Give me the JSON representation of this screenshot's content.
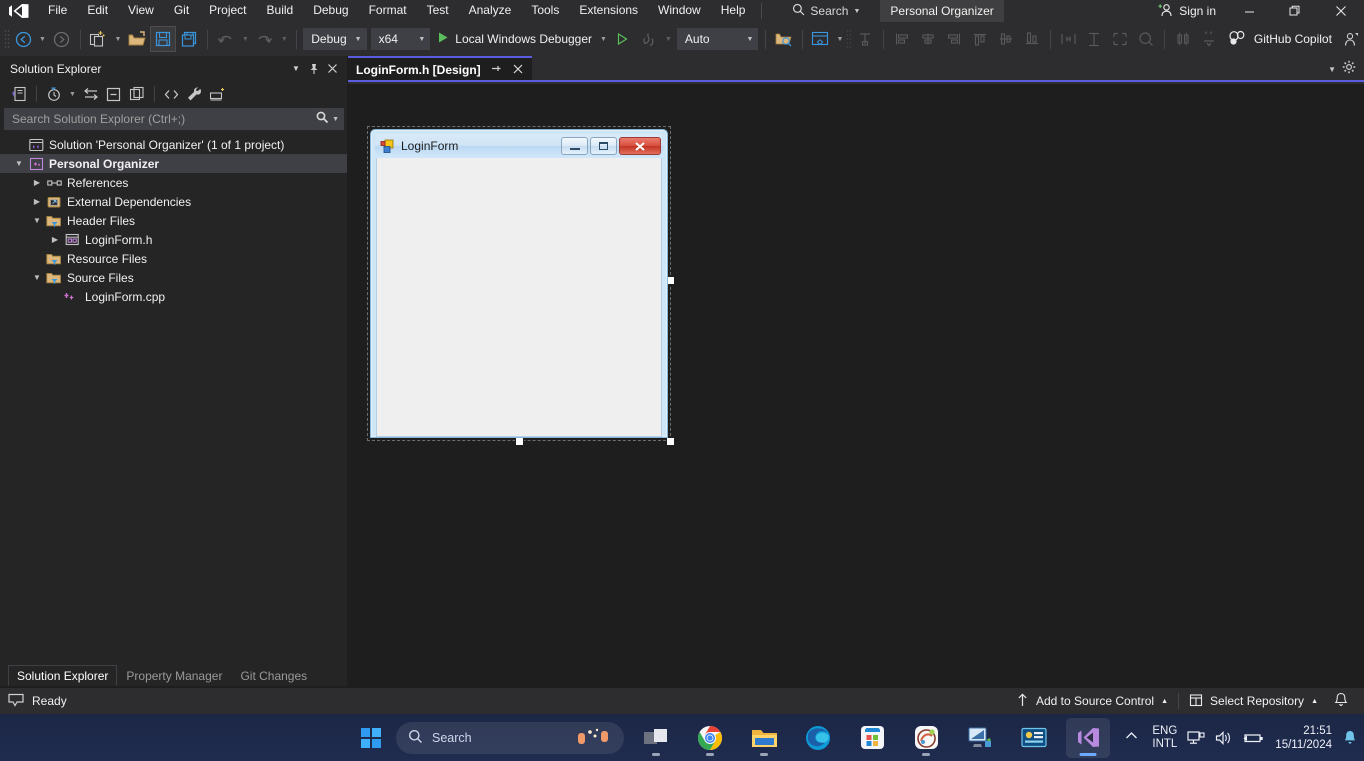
{
  "menubar": {
    "logo": "visual-studio-logo",
    "items": [
      "File",
      "Edit",
      "View",
      "Git",
      "Project",
      "Build",
      "Debug",
      "Format",
      "Test",
      "Analyze",
      "Tools",
      "Extensions",
      "Window",
      "Help"
    ],
    "search_label": "Search",
    "project_chip": "Personal Organizer",
    "signin_label": "Sign in",
    "window_buttons": {
      "minimize": "—",
      "restore": "❐",
      "close": "✕"
    }
  },
  "toolbar": {
    "configuration": "Debug",
    "platform": "x64",
    "run_label": "Local Windows Debugger",
    "process": "Auto",
    "copilot_label": "GitHub Copilot"
  },
  "solution_explorer": {
    "title": "Solution Explorer",
    "search_placeholder": "Search Solution Explorer (Ctrl+;)",
    "tree": [
      {
        "label": "Solution 'Personal Organizer' (1 of 1 project)",
        "icon": "solution-icon",
        "indent": 0,
        "twist": "",
        "bold": false,
        "selected": false
      },
      {
        "label": "Personal Organizer",
        "icon": "cpp-project-icon",
        "indent": 0,
        "twist": "expanded",
        "bold": true,
        "selected": true
      },
      {
        "label": "References",
        "icon": "references-icon",
        "indent": 1,
        "twist": "collapsed",
        "bold": false,
        "selected": false
      },
      {
        "label": "External Dependencies",
        "icon": "dependencies-icon",
        "indent": 1,
        "twist": "collapsed",
        "bold": false,
        "selected": false
      },
      {
        "label": "Header Files",
        "icon": "filter-folder-icon",
        "indent": 1,
        "twist": "expanded",
        "bold": false,
        "selected": false
      },
      {
        "label": "LoginForm.h",
        "icon": "form-file-icon",
        "indent": 2,
        "twist": "collapsed",
        "bold": false,
        "selected": false
      },
      {
        "label": "Resource Files",
        "icon": "filter-folder-icon",
        "indent": 1,
        "twist": "",
        "bold": false,
        "selected": false
      },
      {
        "label": "Source Files",
        "icon": "filter-folder-icon",
        "indent": 1,
        "twist": "expanded",
        "bold": false,
        "selected": false
      },
      {
        "label": "LoginForm.cpp",
        "icon": "cpp-file-icon",
        "indent": 2,
        "twist": "",
        "bold": false,
        "selected": false
      }
    ],
    "dock_tabs": [
      {
        "label": "Solution Explorer",
        "active": true
      },
      {
        "label": "Property Manager",
        "active": false
      },
      {
        "label": "Git Changes",
        "active": false
      }
    ]
  },
  "editor": {
    "tab_title": "LoginForm.h [Design]",
    "pin_glyph": "✒",
    "close_glyph": "✕",
    "accent_color": "#5c5ce0"
  },
  "designer": {
    "form_title": "LoginForm",
    "form_icon": "winforms-icon",
    "titlebar_buttons": {
      "minimize": "minimize-glyph",
      "maximize": "maximize-glyph",
      "close": "X"
    },
    "selected": true
  },
  "status_bar": {
    "ready_text": "Ready",
    "ready_icon": "notify-icon",
    "add_to_source_control": "Add to Source Control",
    "select_repository": "Select Repository",
    "caret_glyph": "▲",
    "bell_icon": "bell-icon"
  },
  "taskbar": {
    "start_icon": "windows-start-icon",
    "search_placeholder": "Search",
    "apps": [
      {
        "name": "task-view-icon",
        "active": false,
        "running": true
      },
      {
        "name": "google-chrome-icon",
        "active": false,
        "running": true
      },
      {
        "name": "file-explorer-icon",
        "active": false,
        "running": true
      },
      {
        "name": "microsoft-edge-icon",
        "active": false,
        "running": false
      },
      {
        "name": "microsoft-store-icon",
        "active": false,
        "running": false
      },
      {
        "name": "paint-icon",
        "active": false,
        "running": true
      },
      {
        "name": "remote-desktop-icon",
        "active": false,
        "running": false
      },
      {
        "name": "settings-monitor-icon",
        "active": false,
        "running": false
      },
      {
        "name": "visual-studio-icon",
        "active": true,
        "running": true
      }
    ],
    "tray": {
      "chevron": "⌃",
      "language_line1": "ENG",
      "language_line2": "INTL",
      "network_icon": "network-icon",
      "volume_icon": "volume-icon",
      "battery_icon": "battery-icon",
      "time": "21:51",
      "date": "15/11/2024",
      "notification_icon": "bell-icon"
    }
  }
}
